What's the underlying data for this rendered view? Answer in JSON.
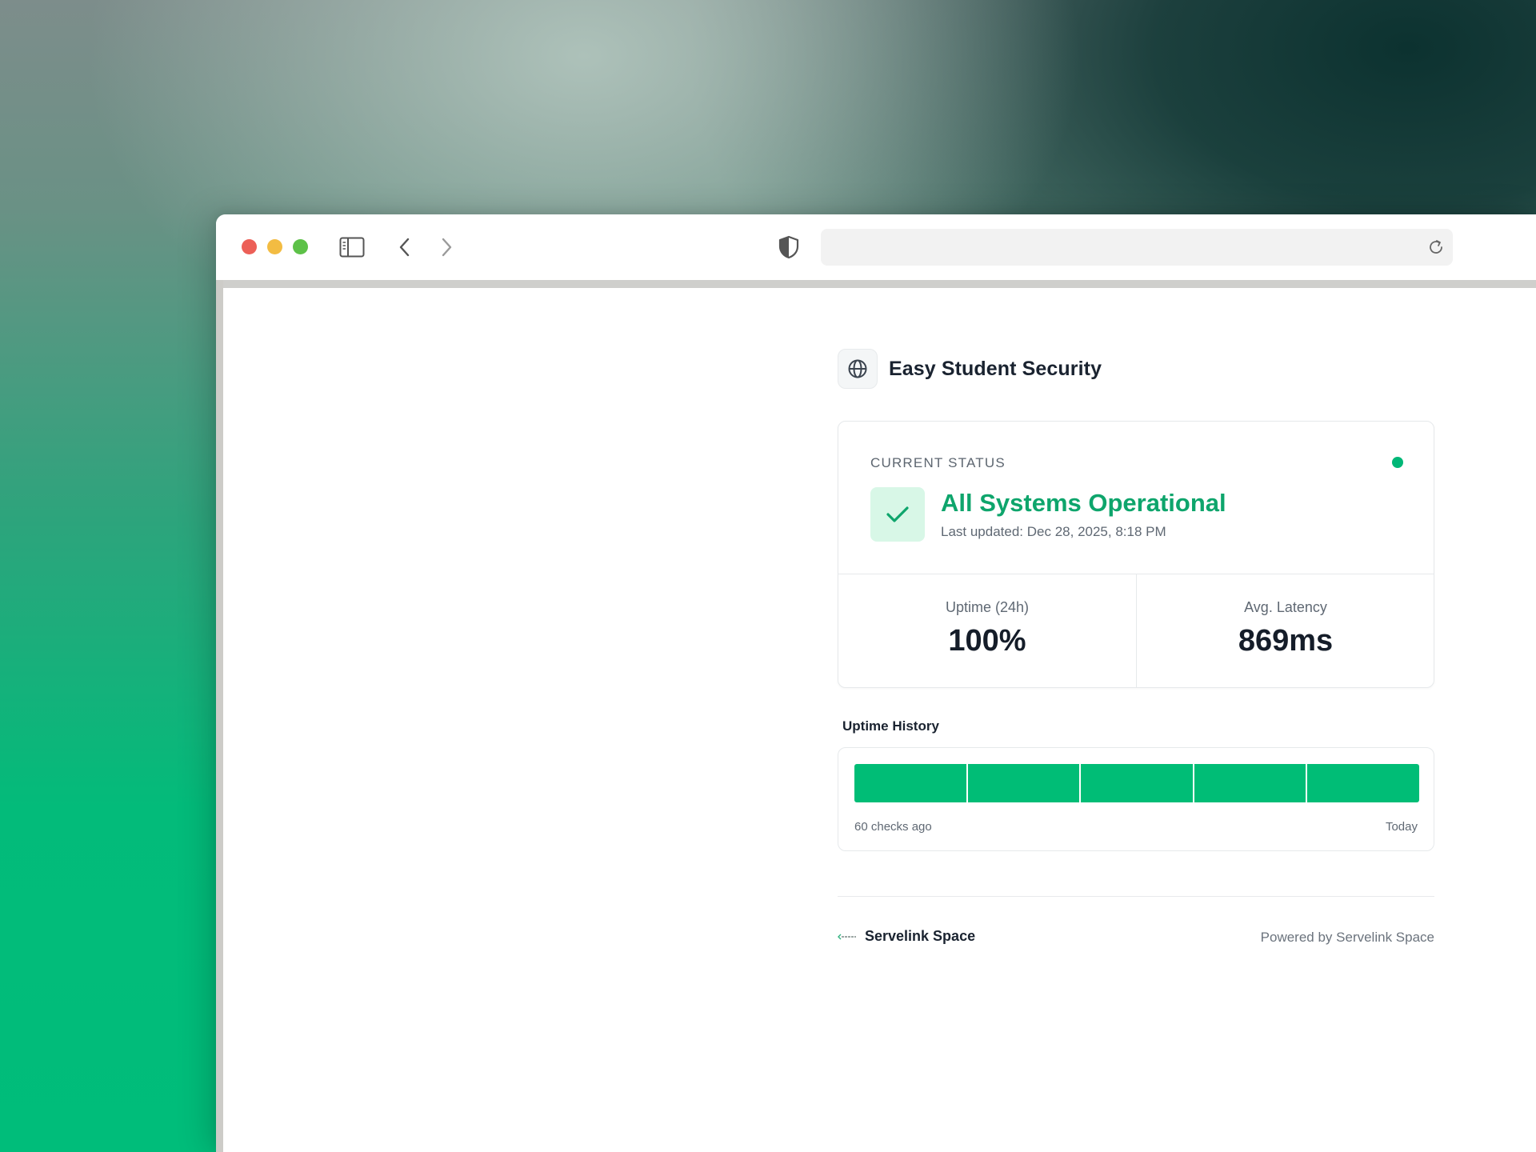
{
  "browser": {
    "url": "",
    "icons": {
      "sidebar": "sidebar-icon",
      "back": "chevron-left-icon",
      "forward": "chevron-right-icon",
      "privacy": "shield-icon",
      "reload": "reload-icon"
    }
  },
  "site": {
    "name": "Easy Student Security",
    "icon": "globe-icon"
  },
  "status": {
    "label": "CURRENT STATUS",
    "title": "All Systems Operational",
    "updated": "Last updated: Dec 28, 2025, 8:18 PM",
    "icon": "check-icon",
    "color": "#0ea56c"
  },
  "metrics": {
    "uptime_label": "Uptime (24h)",
    "uptime_value": "100%",
    "latency_label": "Avg. Latency",
    "latency_value": "869ms"
  },
  "history": {
    "title": "Uptime History",
    "from_label": "60 checks ago",
    "to_label": "Today",
    "segments": 5,
    "segment_color": "#00bd76"
  },
  "footer": {
    "brand_name": "Servelink Space",
    "powered_by": "Powered by Servelink Space"
  }
}
